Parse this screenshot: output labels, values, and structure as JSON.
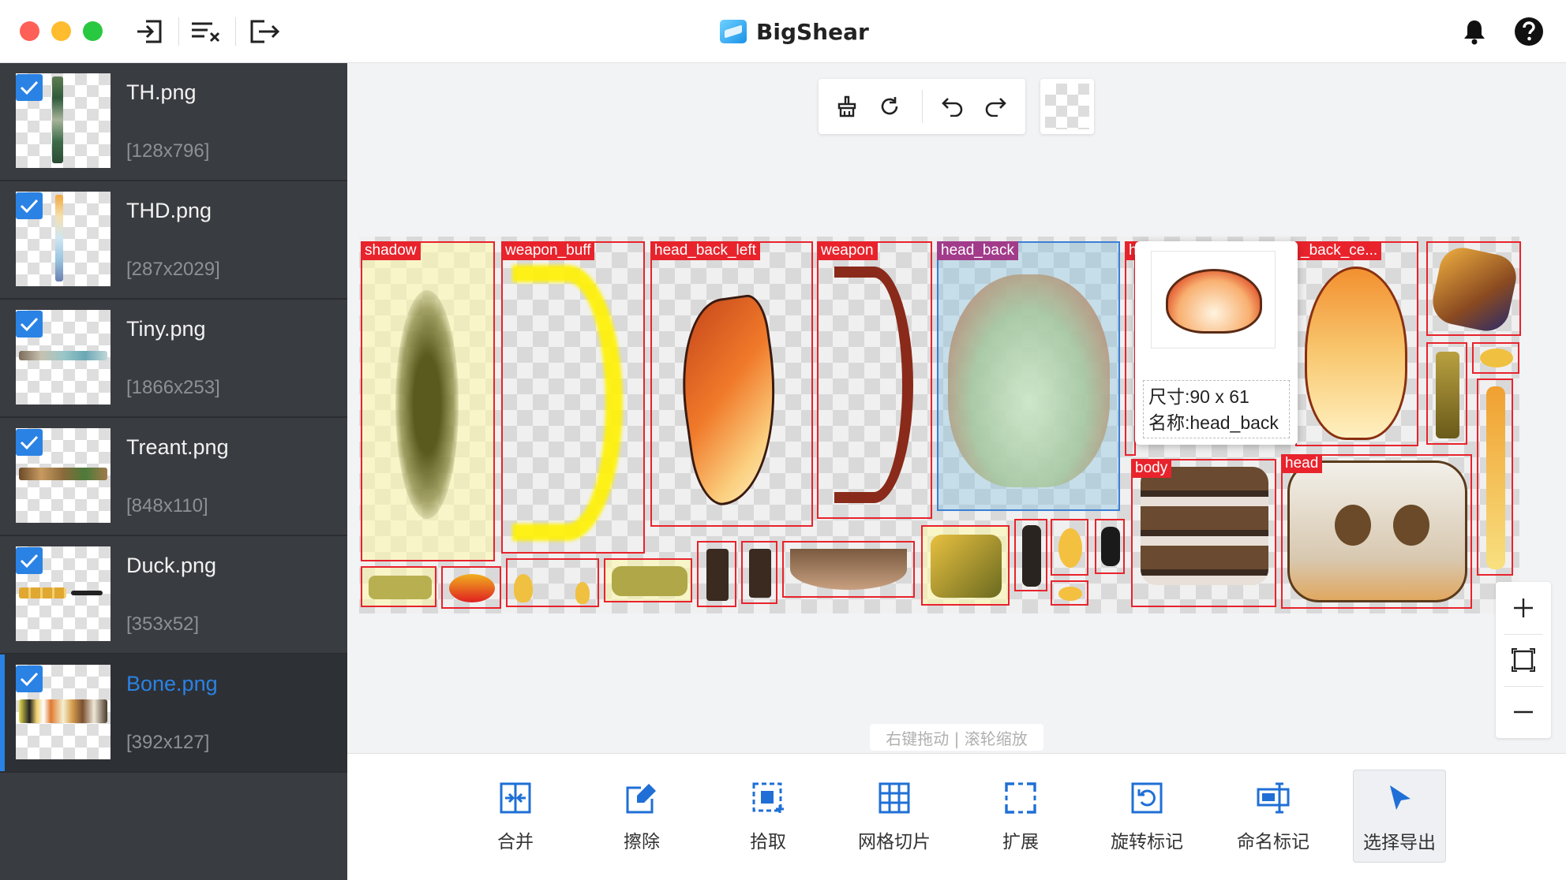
{
  "app": {
    "title": "BigShear"
  },
  "titlebar": {
    "icons": [
      "import-icon",
      "clear-list-icon",
      "export-icon"
    ],
    "right_icons": [
      "bell-icon",
      "help-icon"
    ]
  },
  "files": [
    {
      "name": "TH.png",
      "size": "[128x796]",
      "checked": true
    },
    {
      "name": "THD.png",
      "size": "[287x2029]",
      "checked": true
    },
    {
      "name": "Tiny.png",
      "size": "[1866x253]",
      "checked": true
    },
    {
      "name": "Treant.png",
      "size": "[848x110]",
      "checked": true
    },
    {
      "name": "Duck.png",
      "size": "[353x52]",
      "checked": true
    },
    {
      "name": "Bone.png",
      "size": "[392x127]",
      "checked": true,
      "selected": true
    }
  ],
  "canvas_toolbar": {
    "icons": [
      "brush-clean-icon",
      "refresh-icon",
      "undo-icon",
      "redo-icon"
    ]
  },
  "sprites": [
    {
      "label": "shadow"
    },
    {
      "label": "weapon_buff"
    },
    {
      "label": "head_back_left"
    },
    {
      "label": "weapon"
    },
    {
      "label": "head_back",
      "highlighted": true
    },
    {
      "label": "h"
    },
    {
      "label": "_back_ce..."
    },
    {
      "label": "body"
    },
    {
      "label": "head"
    }
  ],
  "tooltip": {
    "size_text": "尺寸:90 x 61",
    "name_text": "名称:head_back"
  },
  "hint": "右键拖动 | 滚轮缩放",
  "zoom": {
    "icons": [
      "zoom-in-icon",
      "fit-screen-icon",
      "zoom-out-icon"
    ]
  },
  "bottom_tools": [
    {
      "label": "合并",
      "icon": "merge-icon"
    },
    {
      "label": "擦除",
      "icon": "erase-icon"
    },
    {
      "label": "拾取",
      "icon": "pick-icon"
    },
    {
      "label": "网格切片",
      "icon": "grid-slice-icon"
    },
    {
      "label": "扩展",
      "icon": "expand-icon"
    },
    {
      "label": "旋转标记",
      "icon": "rotate-mark-icon"
    },
    {
      "label": "命名标记",
      "icon": "rename-mark-icon"
    },
    {
      "label": "选择导出",
      "icon": "select-export-icon",
      "active": true
    }
  ],
  "colors": {
    "accent": "#2a82e4",
    "sidebar": "#393c40",
    "mark": "#e8232c"
  }
}
